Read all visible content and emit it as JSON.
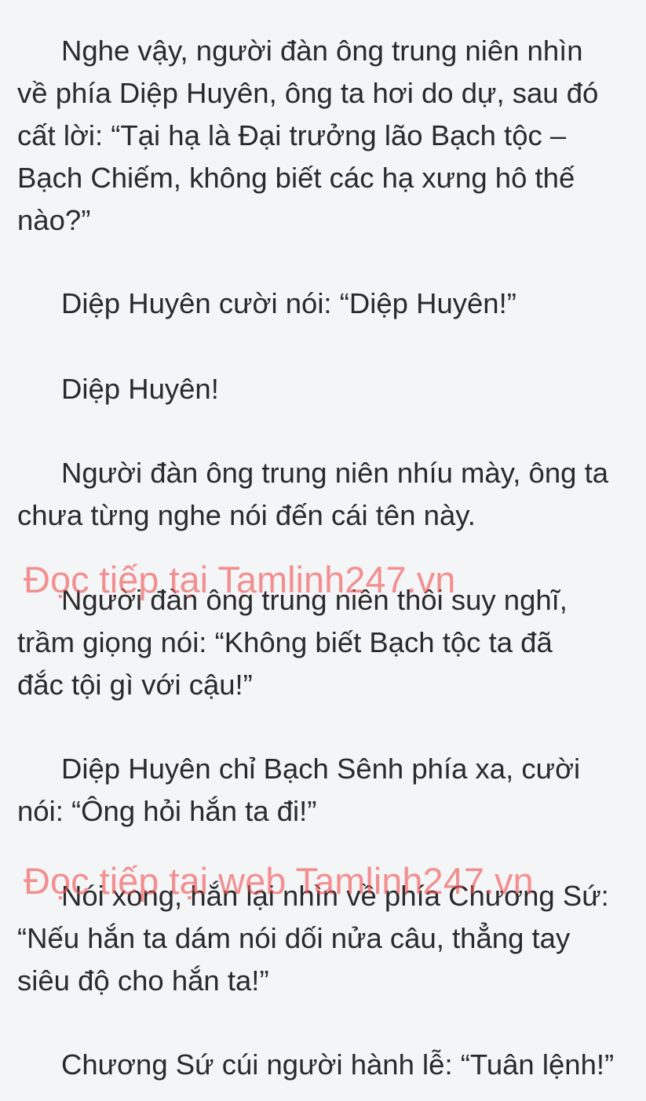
{
  "paragraphs": [
    "Nghe vậy, người đàn ông trung niên nhìn\nvề phía Diệp Huyên, ông ta hơi do dự, sau đó\ncất lời: “Tại hạ là Đại trưởng lão Bạch tộc –\nBạch Chiếm, không biết các hạ xưng hô thế\nnào?”",
    "Diệp Huyên cười nói: “Diệp Huyên!”",
    "Diệp Huyên!",
    "Người đàn ông trung niên nhíu mày, ông ta\nchưa từng nghe nói đến cái tên này.",
    "Người đàn ông trung niên thôi suy nghĩ,\ntrầm giọng nói: “Không biết Bạch tộc ta đã\nđắc tội gì với cậu!”",
    "Diệp Huyên chỉ Bạch Sênh phía xa, cười\nnói: “Ông hỏi hắn ta đi!”",
    "Nói xong, hắn lại nhìn về phía Chương Sứ:\n“Nếu hắn ta dám nói dối nửa câu, thẳng tay\nsiêu độ cho hắn ta!”",
    "Chương Sứ cúi người hành lễ: “Tuân lệnh!”"
  ],
  "watermarks": [
    "Đọc tiếp tại Tamlinh247.vn",
    "Đọc tiếp tại web Tamlinh247.vn"
  ],
  "colors": {
    "background": "#f4f5f7",
    "text": "#2a2a2a",
    "watermark": "#f05050"
  }
}
